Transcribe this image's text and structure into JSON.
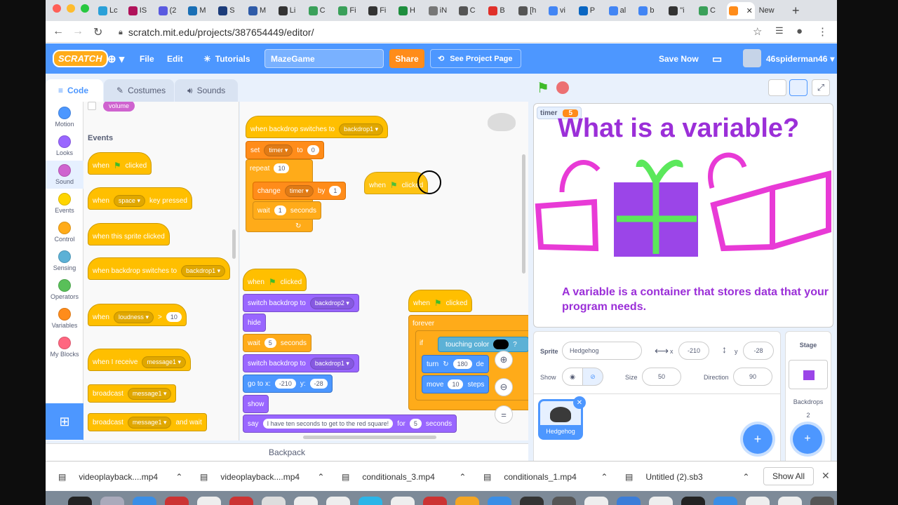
{
  "browser": {
    "tabs": [
      "Lc",
      "IS",
      "(2",
      "M",
      "S",
      "M",
      "Li",
      "C",
      "Fi",
      "Fi",
      "H",
      "iN",
      "C",
      "B",
      "[h",
      "vi",
      "P",
      "al",
      "b",
      "\"i",
      "C",
      "",
      "New"
    ],
    "url": "scratch.mit.edu/projects/387654449/editor/"
  },
  "menubar": {
    "logo": "SCRATCH",
    "file": "File",
    "edit": "Edit",
    "tutorials": "Tutorials",
    "project_title": "MazeGame",
    "share": "Share",
    "see_project_page": "See Project Page",
    "save_now": "Save Now",
    "username": "46spiderman46"
  },
  "tabs": {
    "code": "Code",
    "costumes": "Costumes",
    "sounds": "Sounds"
  },
  "categories": [
    {
      "label": "Motion",
      "color": "#4c97ff"
    },
    {
      "label": "Looks",
      "color": "#9966ff"
    },
    {
      "label": "Sound",
      "color": "#cf63cf"
    },
    {
      "label": "Events",
      "color": "#ffd500"
    },
    {
      "label": "Control",
      "color": "#ffab19"
    },
    {
      "label": "Sensing",
      "color": "#5cb1d6"
    },
    {
      "label": "Operators",
      "color": "#59c059"
    },
    {
      "label": "Variables",
      "color": "#ff8c1a"
    },
    {
      "label": "My Blocks",
      "color": "#ff6680"
    }
  ],
  "palette": {
    "volume": "volume",
    "events_heading": "Events",
    "when": "when",
    "clicked": "clicked",
    "space": "space",
    "key_pressed": "key pressed",
    "when_sprite_clicked": "when this sprite clicked",
    "when_backdrop_switches": "when backdrop switches to",
    "backdrop1": "backdrop1",
    "loudness": "loudness",
    "gt": ">",
    "ten": "10",
    "when_i_receive": "when I receive",
    "message1": "message1",
    "broadcast": "broadcast",
    "and_wait": "and wait"
  },
  "script": {
    "s1_hat": "when backdrop switches to",
    "s1_hat_val": "backdrop1",
    "set": "set",
    "timer": "timer",
    "to": "to",
    "zero": "0",
    "repeat": "repeat",
    "ten": "10",
    "change": "change",
    "by": "by",
    "one": "1",
    "wait": "wait",
    "seconds": "seconds",
    "float_when": "when",
    "float_clicked": "clicked",
    "s2_when": "when",
    "s2_clicked": "clicked",
    "switch_backdrop": "switch backdrop to",
    "backdrop2": "backdrop2",
    "hide": "hide",
    "five": "5",
    "backdrop1": "backdrop1",
    "goto_x": "go to x:",
    "x_val": "-210",
    "y_lbl": "y:",
    "y_val": "-28",
    "show": "show",
    "say": "say",
    "say_text": "I have ten seconds to get to the red square!",
    "for": "for",
    "s3_when": "when",
    "s3_clicked": "clicked",
    "forever": "forever",
    "if": "if",
    "touching_color": "touching color",
    "q": "?",
    "turn": "turn",
    "turn_val": "180",
    "turn_suffix": "de",
    "move": "move",
    "move_val": "10",
    "move_suffix": "steps"
  },
  "backpack": "Backpack",
  "stage": {
    "monitor_label": "timer",
    "monitor_value": "5",
    "title": "What is a variable?",
    "caption": "A variable is a container that stores data that your program needs."
  },
  "sprite_info": {
    "sprite_label": "Sprite",
    "sprite_name": "Hedgehog",
    "x_label": "x",
    "x": "-210",
    "y_label": "y",
    "y": "-28",
    "show_label": "Show",
    "size_label": "Size",
    "size": "50",
    "direction_label": "Direction",
    "direction": "90",
    "thumb_name": "Hedgehog"
  },
  "stage_selector": {
    "title": "Stage",
    "backdrops_label": "Backdrops",
    "backdrops_count": "2"
  },
  "downloads": {
    "items": [
      "videoplayback....mp4",
      "videoplayback....mp4",
      "conditionals_3.mp4",
      "conditionals_1.mp4",
      "Untitled (2).sb3"
    ],
    "show_all": "Show All"
  }
}
